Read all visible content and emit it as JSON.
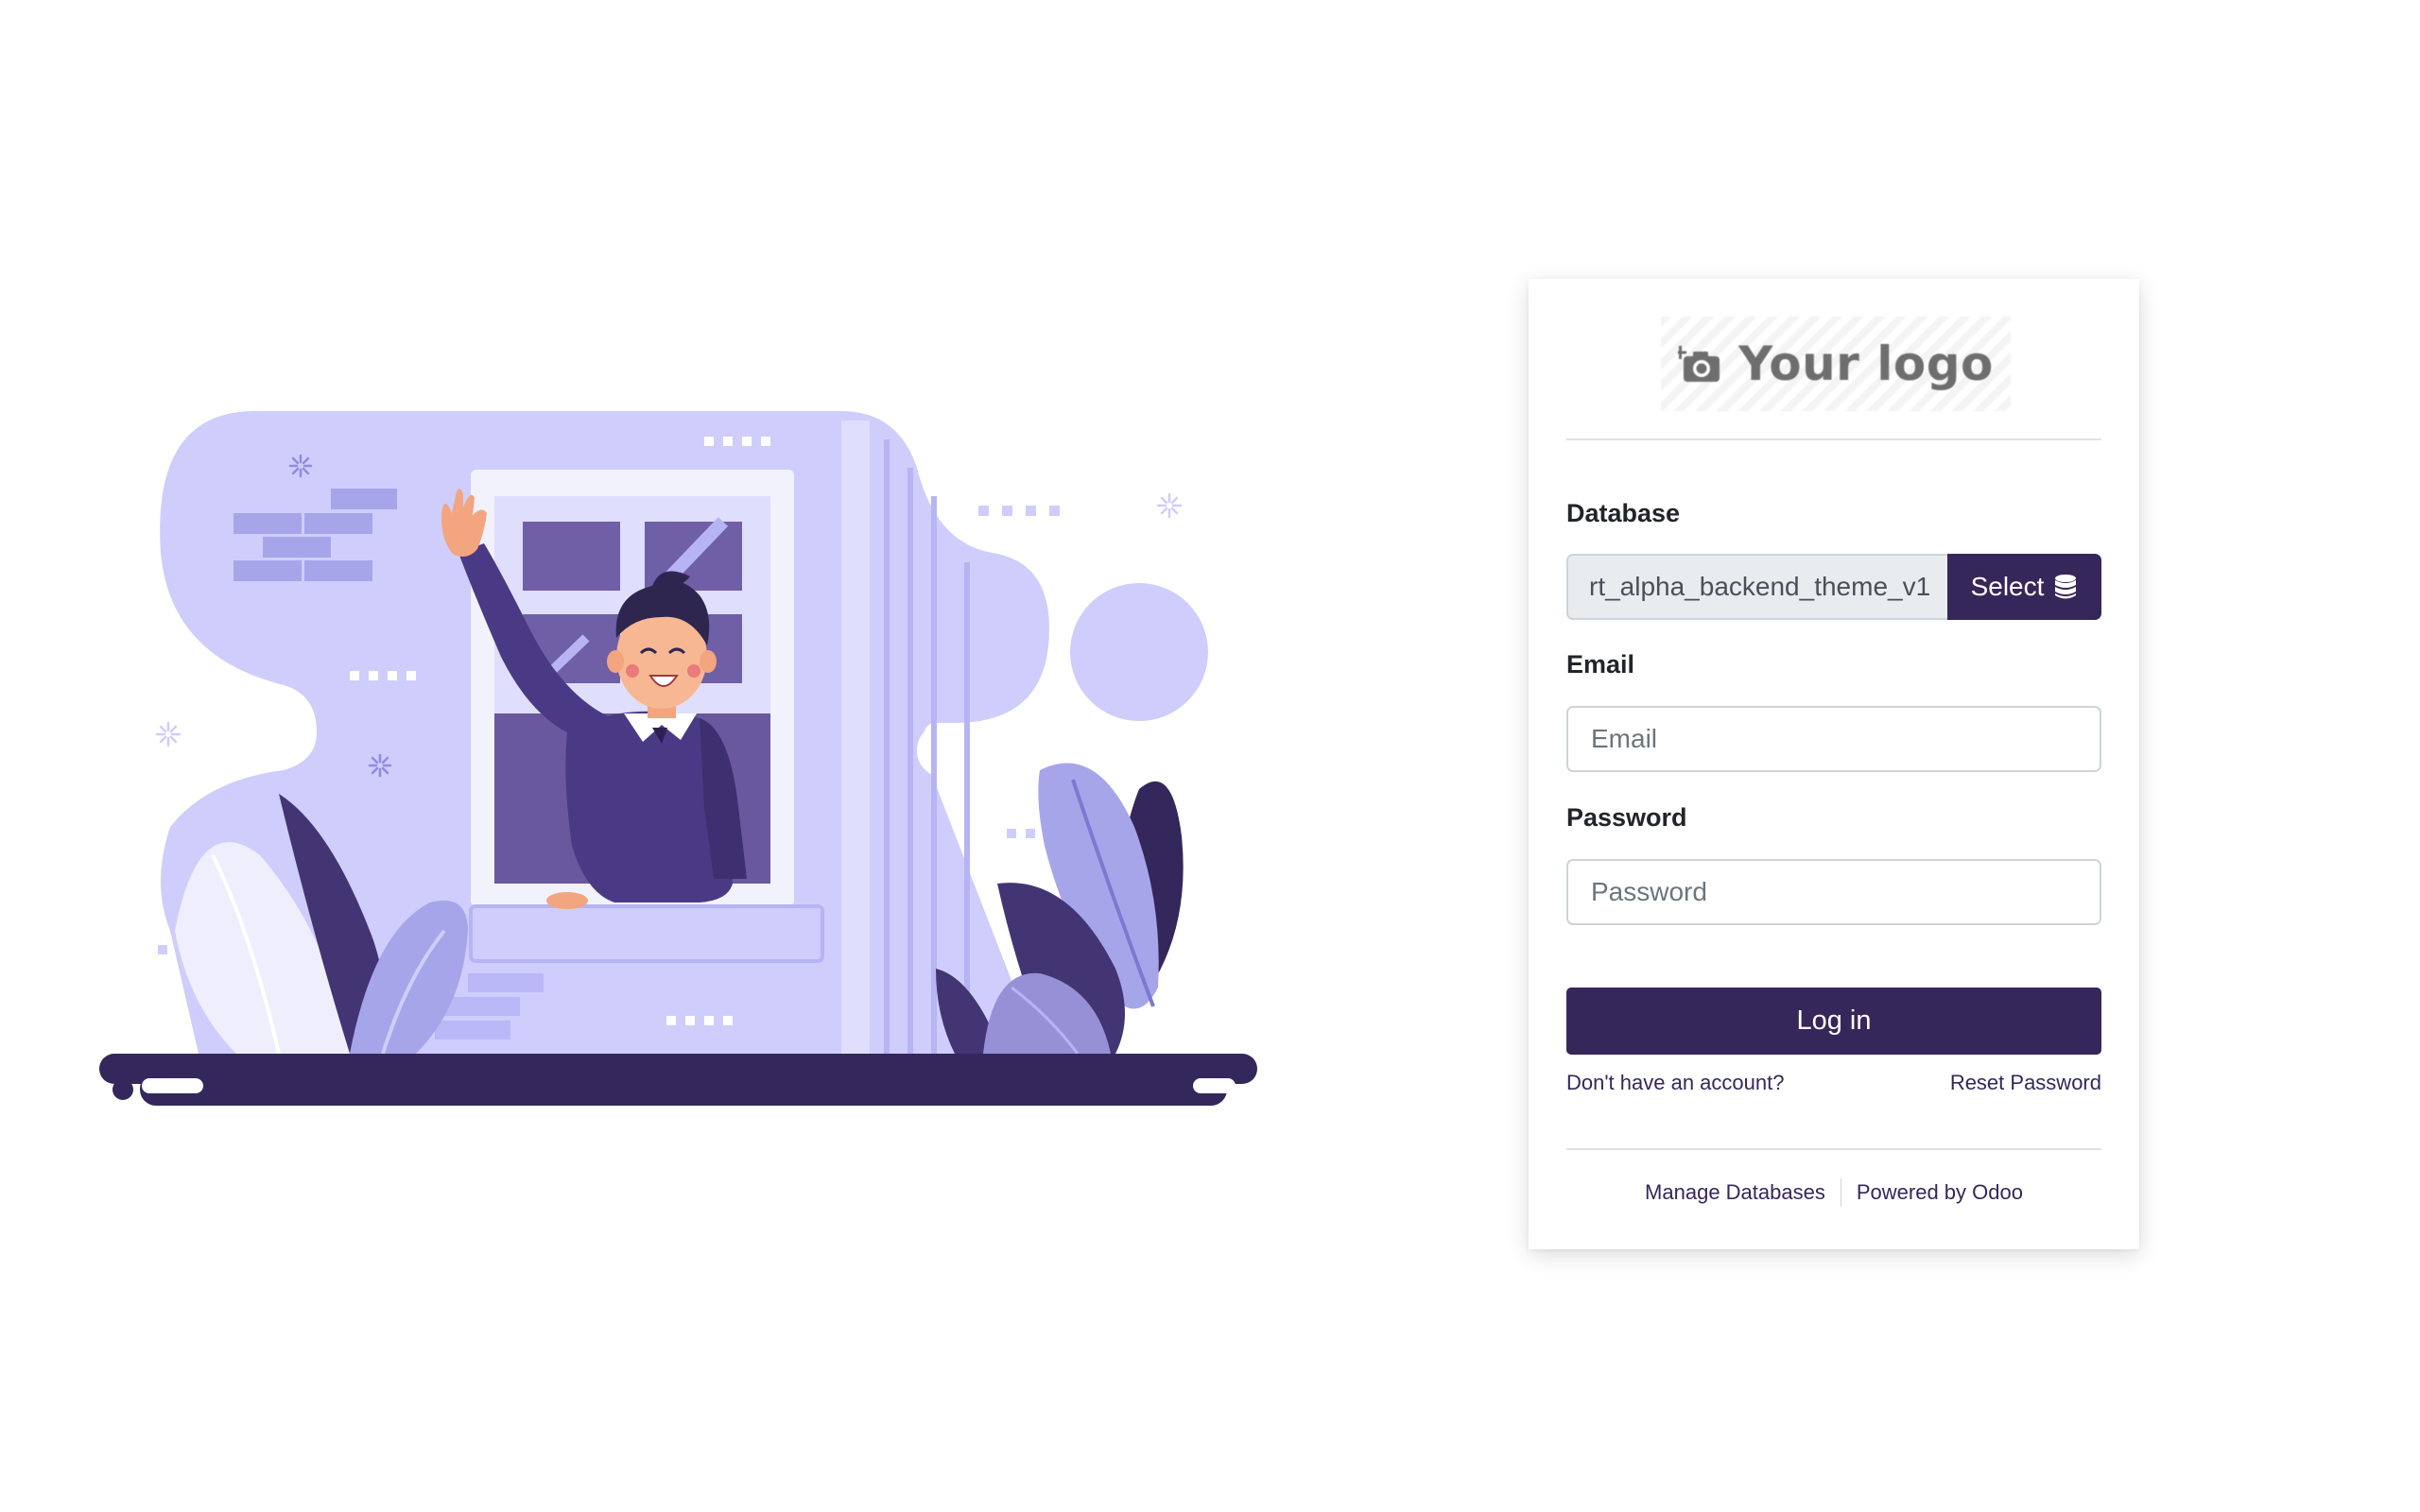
{
  "logo": {
    "text": "Your logo",
    "icon": "add-photo-camera-icon"
  },
  "form": {
    "database": {
      "label": "Database",
      "value": "rt_alpha_backend_theme_v1",
      "select_label": "Select",
      "select_icon": "database-icon"
    },
    "email": {
      "label": "Email",
      "placeholder": "Email"
    },
    "password": {
      "label": "Password",
      "placeholder": "Password"
    },
    "login_label": "Log in",
    "signup_link": "Don't have an account?",
    "reset_link": "Reset Password"
  },
  "footer": {
    "manage_databases": "Manage Databases",
    "powered_by": "Powered by Odoo"
  },
  "colors": {
    "primary": "#35275a",
    "illustration_light": "#cfcdfb",
    "illustration_mid": "#a7a5ea",
    "illustration_dark": "#32275b"
  }
}
